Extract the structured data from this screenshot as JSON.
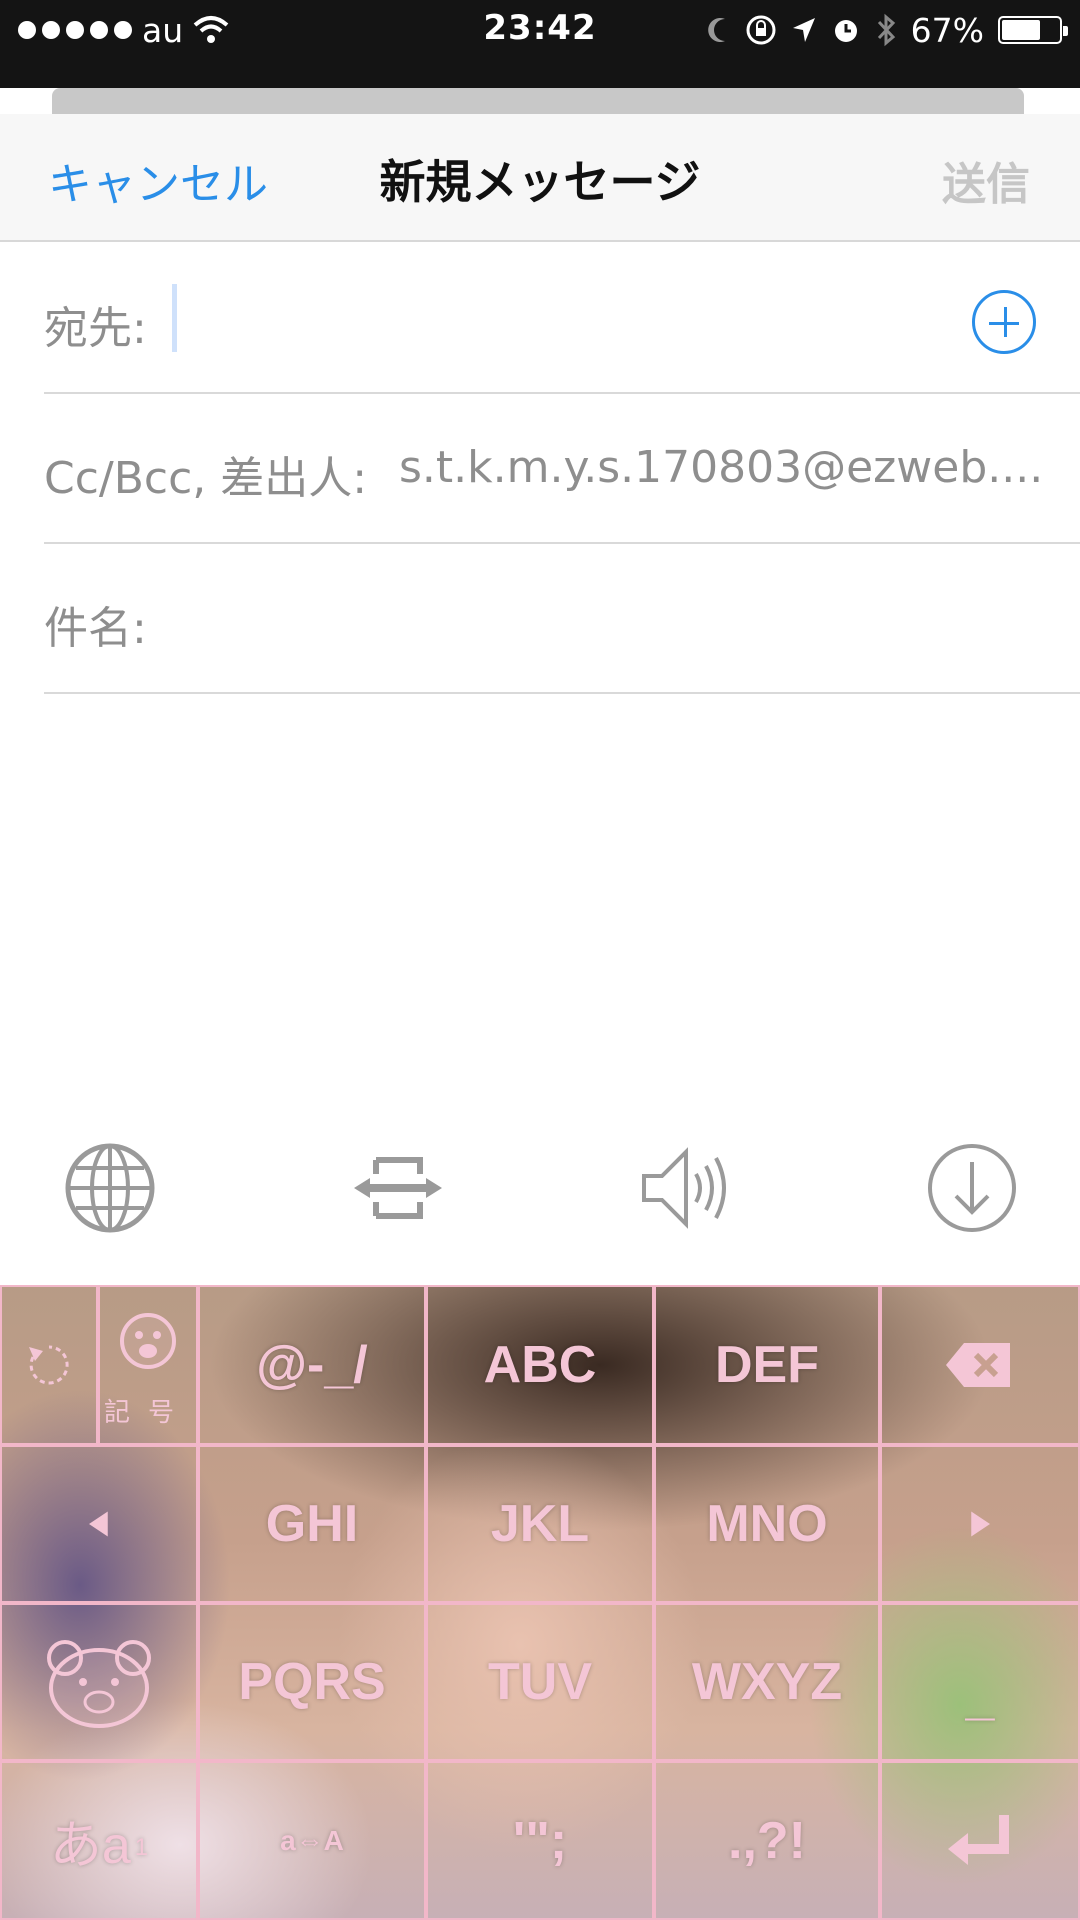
{
  "status_bar": {
    "carrier": "au",
    "time": "23:42",
    "battery_percent": "67%",
    "battery_level": 0.67,
    "icons": [
      "signal-dots-icon",
      "wifi-icon",
      "moon-icon",
      "rotation-lock-icon",
      "location-icon",
      "alarm-icon",
      "bluetooth-icon",
      "battery-icon"
    ]
  },
  "nav": {
    "cancel": "キャンセル",
    "title": "新規メッセージ",
    "send": "送信"
  },
  "fields": {
    "to_label": "宛先:",
    "cc_label": "Cc/Bcc, 差出人:",
    "from_value": "s.t.k.m.y.s.170803@ezweb....",
    "subject_label": "件名:"
  },
  "toolbar": {
    "icons": [
      "globe-icon",
      "cursor-arrows-icon",
      "speaker-icon",
      "dismiss-keyboard-icon"
    ]
  },
  "keyboard": {
    "kigou": "記号",
    "row1": [
      "@-_/",
      "ABC",
      "DEF"
    ],
    "row2": [
      "GHI",
      "JKL",
      "MNO"
    ],
    "row3": [
      "PQRS",
      "TUV",
      "WXYZ"
    ],
    "dash": "_",
    "mode": "あa",
    "mode_sup": "1",
    "case": "a⇔A",
    "punct1": "'\";",
    "punct2": ".,?!",
    "accent": "#2a8ee8",
    "key_color": "#f4c6d6"
  }
}
